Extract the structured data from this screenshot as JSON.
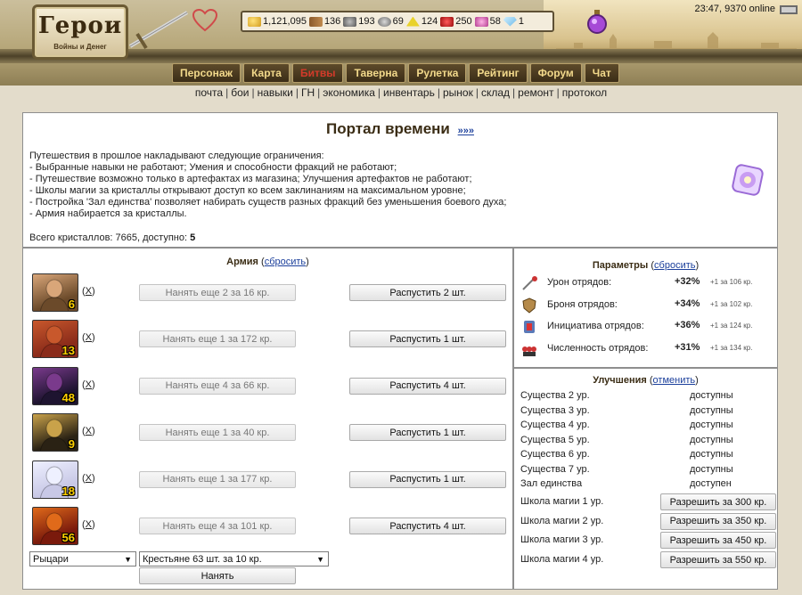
{
  "header": {
    "logo_title": "Герои",
    "logo_subtitle": "Войны и Денег",
    "clock": "23:47, 9370 online",
    "resources": [
      {
        "icon": "gold-icon",
        "cls": "res-gold",
        "value": "1,121,095"
      },
      {
        "icon": "wood-icon",
        "cls": "res-wood",
        "value": "136"
      },
      {
        "icon": "ore-icon",
        "cls": "res-ore",
        "value": "193"
      },
      {
        "icon": "mercury-icon",
        "cls": "res-merc",
        "value": "69"
      },
      {
        "icon": "sulfur-icon",
        "cls": "res-sulf",
        "value": "124"
      },
      {
        "icon": "crystal-icon",
        "cls": "res-crys",
        "value": "250"
      },
      {
        "icon": "gems-icon",
        "cls": "res-gem",
        "value": "58"
      },
      {
        "icon": "diamond-icon",
        "cls": "res-diam",
        "value": "1"
      }
    ],
    "menu": [
      "Персонаж",
      "Карта",
      "Битвы",
      "Таверна",
      "Рулетка",
      "Рейтинг",
      "Форум",
      "Чат"
    ],
    "menu_active": 2,
    "subnav": [
      "почта",
      "бои",
      "навыки",
      "ГН",
      "экономика",
      "инвентарь",
      "рынок",
      "склад",
      "ремонт",
      "протокол"
    ]
  },
  "portal": {
    "title": "Портал времени",
    "more_link": "»»»",
    "rules": [
      "Путешествия в прошлое накладывают следующие ограничения:",
      "- Выбранные навыки не работают; Умения и способности фракций не работают;",
      "- Путешествие возможно только в артефактах из магазина; Улучшения артефактов не работают;",
      "- Школы магии за кристаллы открывают доступ ко всем заклинаниям на максимальном уровне;",
      "- Постройка 'Зал единства' позволяет набирать существ разных фракций без уменьшения боевого духа;",
      "- Армия набирается за кристаллы."
    ],
    "crystals_label": "Всего кристаллов: 7665, доступно: ",
    "crystals_available": "5"
  },
  "army": {
    "title": "Армия",
    "reset": "сбросить",
    "remove_label": "X",
    "units": [
      {
        "count": "6",
        "hire": "Нанять еще 2 за 16 кр.",
        "dismiss": "Распустить 2 шт.",
        "bg": "#6b4a2a",
        "skin": "#d9a679"
      },
      {
        "count": "13",
        "hire": "Нанять еще 1 за 172 кр.",
        "dismiss": "Распустить 1 шт.",
        "bg": "#8a2b1a",
        "skin": "#c8582c"
      },
      {
        "count": "48",
        "hire": "Нанять еще 4 за 66 кр.",
        "dismiss": "Распустить 4 шт.",
        "bg": "#1e1430",
        "skin": "#7a3a8c"
      },
      {
        "count": "9",
        "hire": "Нанять еще 1 за 40 кр.",
        "dismiss": "Распустить 1 шт.",
        "bg": "#2a2214",
        "skin": "#c9a24a"
      },
      {
        "count": "18",
        "hire": "Нанять еще 1 за 177 кр.",
        "dismiss": "Распустить 1 шт.",
        "bg": "#c8c8e6",
        "skin": "#eef0ff"
      },
      {
        "count": "56",
        "hire": "Нанять еще 4 за 101 кр.",
        "dismiss": "Распустить 4 шт.",
        "bg": "#7a1a0c",
        "skin": "#e06a1a"
      }
    ],
    "faction_select": "Рыцари",
    "creature_select": "Крестьяне 63 шт. за 10 кр.",
    "hire_button": "Нанять"
  },
  "params": {
    "title": "Параметры",
    "reset": "сбросить",
    "rows": [
      {
        "icon": "damage-icon",
        "label": "Урон отрядов:",
        "value": "+32%",
        "note": "+1 за 106 кр."
      },
      {
        "icon": "armor-icon",
        "label": "Броня отрядов:",
        "value": "+34%",
        "note": "+1 за 102 кр."
      },
      {
        "icon": "initiative-icon",
        "label": "Инициатива отрядов:",
        "value": "+36%",
        "note": "+1 за 124 кр."
      },
      {
        "icon": "quantity-icon",
        "label": "Численность отрядов:",
        "value": "+31%",
        "note": "+1 за 134 кр."
      }
    ]
  },
  "upgrades": {
    "title": "Улучшения",
    "cancel": "отменить",
    "rows": [
      {
        "name": "Существа 2 ур.",
        "status": "доступны"
      },
      {
        "name": "Существа 3 ур.",
        "status": "доступны"
      },
      {
        "name": "Существа 4 ур.",
        "status": "доступны"
      },
      {
        "name": "Существа 5 ур.",
        "status": "доступны"
      },
      {
        "name": "Существа 6 ур.",
        "status": "доступны"
      },
      {
        "name": "Существа 7 ур.",
        "status": "доступны"
      },
      {
        "name": "Зал единства",
        "status": "доступен"
      }
    ],
    "schools": [
      {
        "name": "Школа магии 1 ур.",
        "button": "Разрешить за 300 кр."
      },
      {
        "name": "Школа магии 2 ур.",
        "button": "Разрешить за 350 кр."
      },
      {
        "name": "Школа магии 3 ур.",
        "button": "Разрешить за 450 кр."
      },
      {
        "name": "Школа магии 4 ур.",
        "button": "Разрешить за 550 кр."
      }
    ]
  }
}
